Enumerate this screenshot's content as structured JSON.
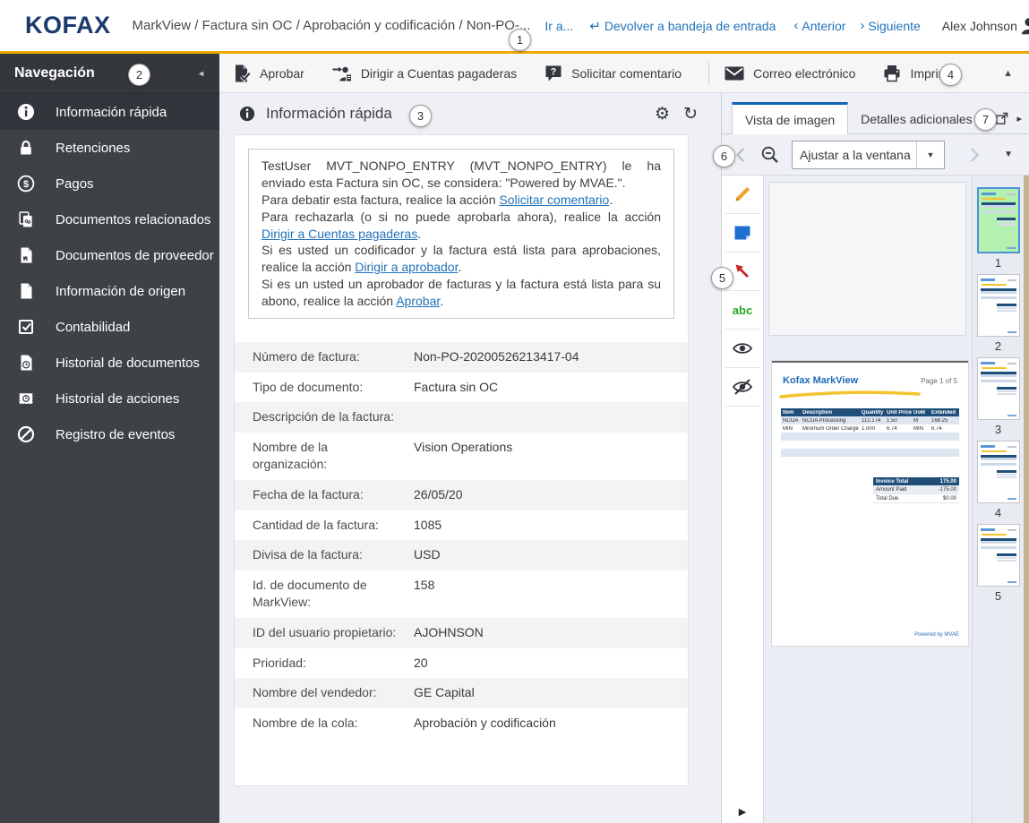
{
  "theme": {
    "accent_yellow": "#eea904",
    "kofax_blue": "#1b3a6b",
    "link_blue": "#2272b9",
    "active_tab_blue": "#1464ba",
    "sidebar_bg": "#3e4247",
    "selected_thumb_green": "#b4f0ae",
    "invoice_navy": "#1f4e79",
    "marker_orange": "#f0a32a",
    "note_blue": "#1d6fd1",
    "arrow_red": "#c8262c",
    "abc_green": "#1faa1f"
  },
  "icons": {
    "return_glyph": "↵",
    "prev_glyph": "‹",
    "next_glyph": "›",
    "gear_glyph": "⚙",
    "refresh_glyph": "↻",
    "collapse_left_glyph": "◄",
    "collapse_up_glyph": "▲",
    "caret_down_glyph": "▼",
    "chevron_right_glyph": "▸",
    "expand_right_glyph": "▶",
    "abc_label": "abc"
  },
  "header": {
    "logo": "KOFAX",
    "breadcrumb": "MarkView / Factura sin OC / Aprobación y codificación / Non-PO-...",
    "go_to": "Ir a...",
    "return_to_inbox": "Devolver a bandeja de entrada",
    "prev": "Anterior",
    "next": "Siguiente",
    "user": "Alex Johnson"
  },
  "callouts": [
    "1",
    "2",
    "3",
    "4",
    "5",
    "6",
    "7"
  ],
  "sidebar": {
    "title": "Navegación",
    "items": [
      {
        "label": "Información rápida",
        "selected": true
      },
      {
        "label": "Retenciones"
      },
      {
        "label": "Pagos"
      },
      {
        "label": "Documentos relacionados"
      },
      {
        "label": "Documentos de proveedor"
      },
      {
        "label": "Información de origen"
      },
      {
        "label": "Contabilidad"
      },
      {
        "label": "Historial de documentos"
      },
      {
        "label": "Historial de acciones"
      },
      {
        "label": "Registro de eventos"
      }
    ]
  },
  "toolbar": {
    "approve": "Aprobar",
    "route": "Dirigir a Cuentas pagaderas",
    "comment": "Solicitar comentario",
    "email": "Correo electrónico",
    "print": "Imprimir"
  },
  "quick_info": {
    "title": "Información rápida",
    "message_lines": [
      [
        {
          "text": "TestUser MVT_NONPO_ENTRY (MVT_NONPO_ENTRY) le ha enviado esta Factura sin OC, se considera: \"Powered by MVAE.\"."
        }
      ],
      [
        {
          "text": "Para debatir esta factura, realice la acción "
        },
        {
          "link": "Solicitar comentario"
        },
        {
          "text": "."
        }
      ],
      [
        {
          "text": "Para rechazarla (o si no puede aprobarla ahora), realice la acción "
        },
        {
          "link": "Dirigir a Cuentas pagaderas"
        },
        {
          "text": "."
        }
      ],
      [
        {
          "text": "Si es usted un codificador y la factura está lista para aprobaciones, realice la acción "
        },
        {
          "link": "Dirigir a aprobador"
        },
        {
          "text": "."
        }
      ],
      [
        {
          "text": "Si es un usted un aprobador de facturas y la factura está lista para su abono, realice la acción "
        },
        {
          "link": "Aprobar"
        },
        {
          "text": "."
        }
      ]
    ],
    "fields": [
      {
        "label": "Número de factura:",
        "value": "Non-PO-20200526213417-04"
      },
      {
        "label": "Tipo de documento:",
        "value": "Factura sin OC"
      },
      {
        "label": "Descripción de la factura:",
        "value": ""
      },
      {
        "label": "Nombre de la organización:",
        "value": "Vision Operations"
      },
      {
        "label": "Fecha de la factura:",
        "value": "26/05/20"
      },
      {
        "label": "Cantidad de la factura:",
        "value": "1085"
      },
      {
        "label": "Divisa de la factura:",
        "value": "USD"
      },
      {
        "label": "Id. de documento de MarkView:",
        "value": "158"
      },
      {
        "label": "ID del usuario propietario:",
        "value": "AJOHNSON"
      },
      {
        "label": "Prioridad:",
        "value": "20"
      },
      {
        "label": "Nombre del vendedor:",
        "value": "GE Capital"
      },
      {
        "label": "Nombre de la cola:",
        "value": "Aprobación y codificación"
      }
    ]
  },
  "viewer": {
    "tabs": [
      "Vista de imagen",
      "Detalles adicionales"
    ],
    "fit_dropdown": "Ajustar a la ventana",
    "page": {
      "brand": "Kofax MarkView",
      "page_label": "Page 1 of 5",
      "footer": "Powered by MVAE",
      "table": {
        "headers": [
          "Item",
          "Description",
          "Quantity",
          "Unit Price",
          "UoM",
          "Extended"
        ],
        "rows": [
          [
            "NCOA",
            "NCOA Processing",
            "112.174",
            "1.50",
            "M",
            "168.25"
          ],
          [
            "MIN",
            "Minimum Order Charge",
            "1.000",
            "6.74",
            "MIN",
            "6.74"
          ]
        ],
        "empty_rows": 4
      },
      "totals": [
        {
          "label": "Invoice Total",
          "value": "175.00"
        },
        {
          "label": "Amount Paid",
          "value": "-175.00"
        },
        {
          "label": "Total Due",
          "value": "$0.00"
        }
      ]
    },
    "thumbnails": [
      {
        "page": "1",
        "selected": true
      },
      {
        "page": "2"
      },
      {
        "page": "3"
      },
      {
        "page": "4"
      },
      {
        "page": "5"
      }
    ]
  }
}
